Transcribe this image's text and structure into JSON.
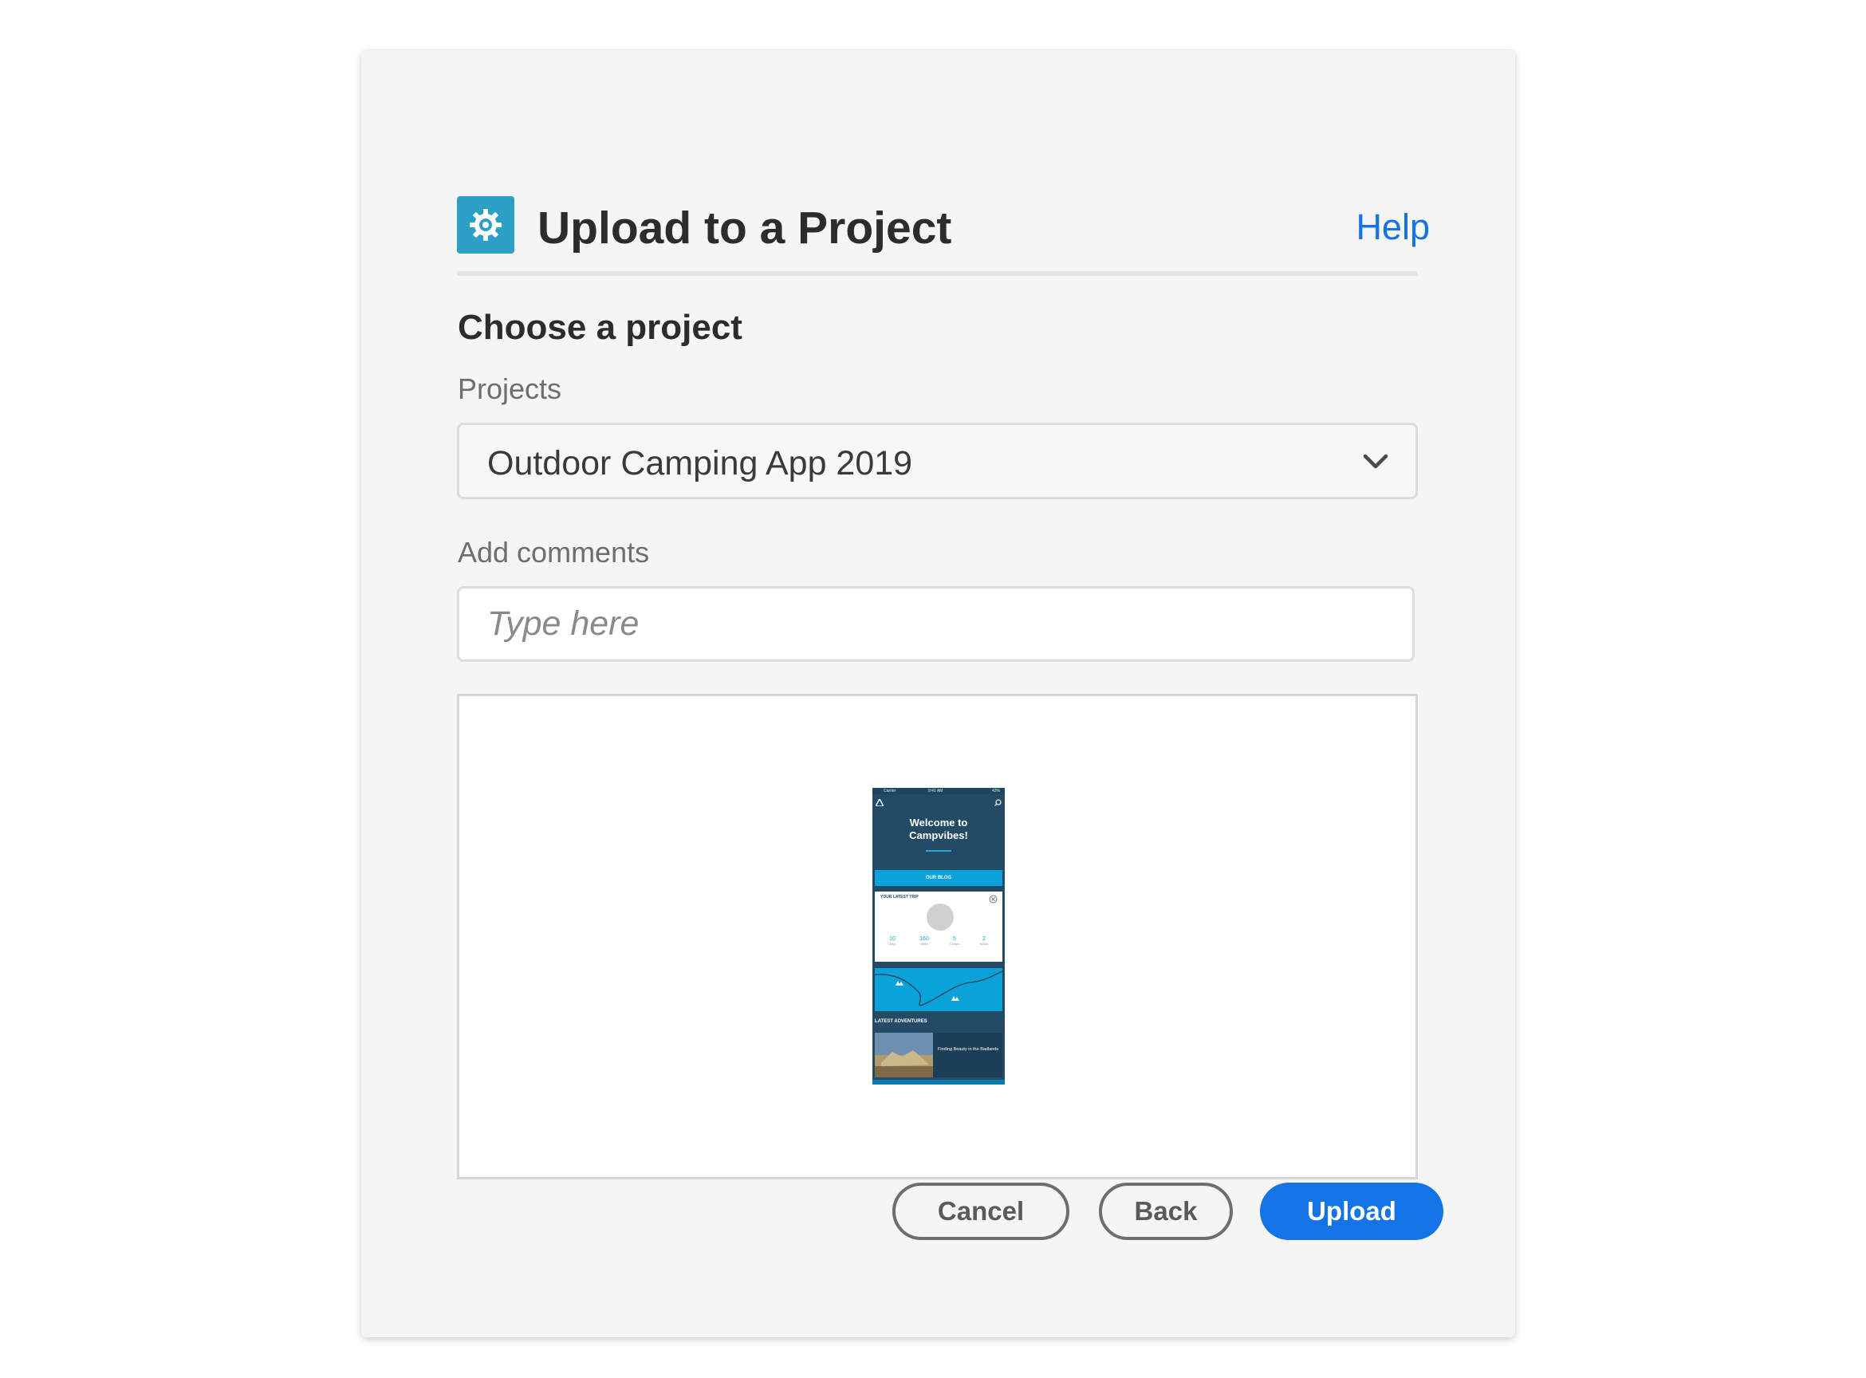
{
  "dialog": {
    "title": "Upload to a Project",
    "help_label": "Help",
    "app_icon": "gear-icon",
    "accent_color": "#2ca1c8",
    "link_color": "#1473e6"
  },
  "form": {
    "section_title": "Choose a project",
    "projects_label": "Projects",
    "selected_project": "Outdoor Camping App 2019",
    "comments_label": "Add comments",
    "comments_placeholder": "Type here",
    "comments_value": ""
  },
  "preview": {
    "status_left": "Carrier",
    "status_time": "9:41 AM",
    "status_right": "42%",
    "hero_text": "Welcome to Campvibes!",
    "blog_button": "OUR BLOG",
    "trip_title": "YOUR LATEST TRIP",
    "stats": [
      {
        "value": "10",
        "label": "Days"
      },
      {
        "value": "160",
        "label": "Miles"
      },
      {
        "value": "5",
        "label": "Camps"
      },
      {
        "value": "2",
        "label": "Bears"
      }
    ],
    "adventures_title": "LATEST ADVENTURES",
    "adventure_text": "Finding Beauty in the Badlands"
  },
  "buttons": {
    "cancel": "Cancel",
    "back": "Back",
    "upload": "Upload",
    "primary_color": "#1473e6"
  }
}
